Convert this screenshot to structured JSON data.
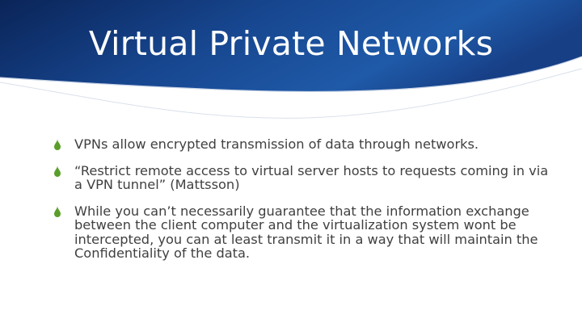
{
  "slide": {
    "title": "Virtual Private Networks",
    "bullets": [
      {
        "icon": "droplet-icon",
        "text": "VPNs allow encrypted transmission of data through networks."
      },
      {
        "icon": "droplet-icon",
        "text": "“Restrict remote access to virtual server hosts to requests coming in via a VPN tunnel” (Mattsson)"
      },
      {
        "icon": "droplet-icon",
        "text": "While you can’t necessarily guarantee that the information exchange between the client computer and the virtualization system wont be intercepted, you can at least transmit it in a way that will maintain the Confidentiality of the data."
      }
    ]
  },
  "colors": {
    "header_dark": "#0b2a63",
    "header_mid": "#1f5aa8",
    "bullet_green": "#5a9e2a",
    "text": "#404040"
  }
}
